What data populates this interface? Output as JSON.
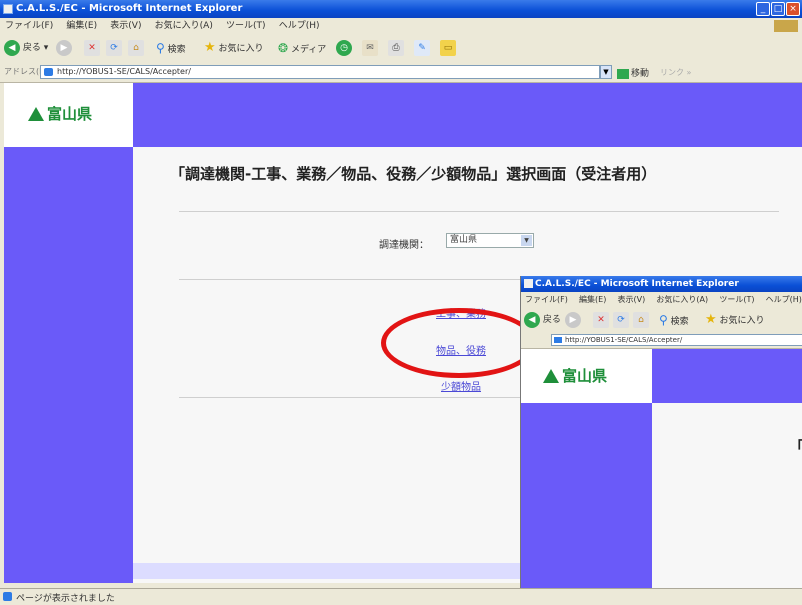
{
  "window": {
    "title": "C.A.L.S./EC - Microsoft Internet Explorer",
    "menu": [
      "ファイル(F)",
      "編集(E)",
      "表示(V)",
      "お気に入り(A)",
      "ツール(T)",
      "ヘルプ(H)"
    ],
    "toolbar": {
      "back": "戻る",
      "search": "検索",
      "favorites": "お気に入り",
      "media": "メディア"
    },
    "address": {
      "label": "アドレス(D)",
      "url": "http://YOBUS1-SE/CALS/Accepter/",
      "go": "移動",
      "links": "リンク"
    },
    "status": "ページが表示されました"
  },
  "page": {
    "logo": "富山県",
    "heading": "「調達機関-工事、業務／物品、役務／少額物品」選択画面（受注者用）",
    "org_label": "調達機関：",
    "org_value": "富山県",
    "links": [
      "工事、業務",
      "物品、役務",
      "少額物品"
    ]
  },
  "overlay": {
    "title": "C.A.L.S./EC - Microsoft Internet Explorer",
    "menu": [
      "ファイル(F)",
      "編集(E)",
      "表示(V)",
      "お気に入り(A)",
      "ツール(T)",
      "ヘルプ(H)"
    ],
    "toolbar": {
      "back": "戻る",
      "search": "検索",
      "favorites": "お気に入り"
    },
    "url": "http://YOBUS1-SE/CALS/Accepter/",
    "logo": "富山県",
    "heading_fragment": "「"
  },
  "colors": {
    "accent": "#6a5af9",
    "logo": "#1f8f3a",
    "highlight": "#e21414",
    "link": "#4b49d6"
  }
}
